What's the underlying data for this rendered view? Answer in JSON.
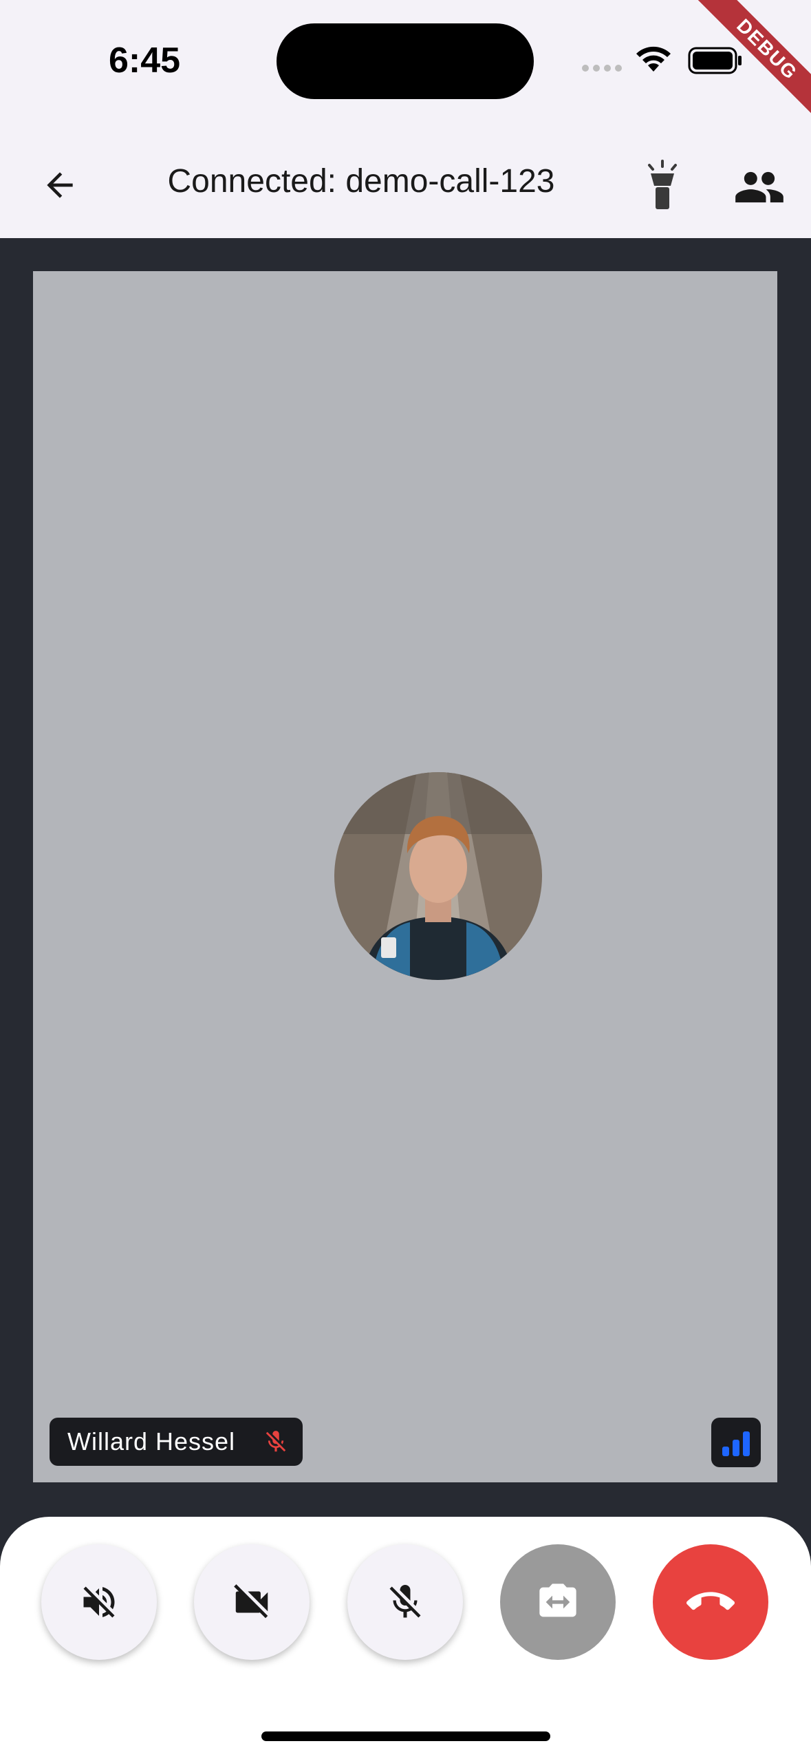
{
  "status_bar": {
    "time": "6:45",
    "debug_banner": "DEBUG"
  },
  "app_bar": {
    "title": "Connected: demo-call-123"
  },
  "participant": {
    "name": "Willard Hessel",
    "mic_muted": true
  },
  "icons": {
    "back": "arrow-back-icon",
    "torch": "flashlight-icon",
    "participants": "people-icon",
    "mic_off": "mic-off-icon",
    "network": "signal-bars-icon",
    "speaker_off": "volume-off-icon",
    "video_off": "videocam-off-icon",
    "switch_camera": "switch-camera-icon",
    "hang_up": "call-end-icon"
  },
  "colors": {
    "app_bar_bg": "#f4f2f8",
    "call_bg": "#272a32",
    "tile_bg": "#b3b5ba",
    "hang_up": "#e8423f",
    "muted_mic": "#e8423f",
    "network": "#1e66ff",
    "debug": "#b5333a"
  }
}
